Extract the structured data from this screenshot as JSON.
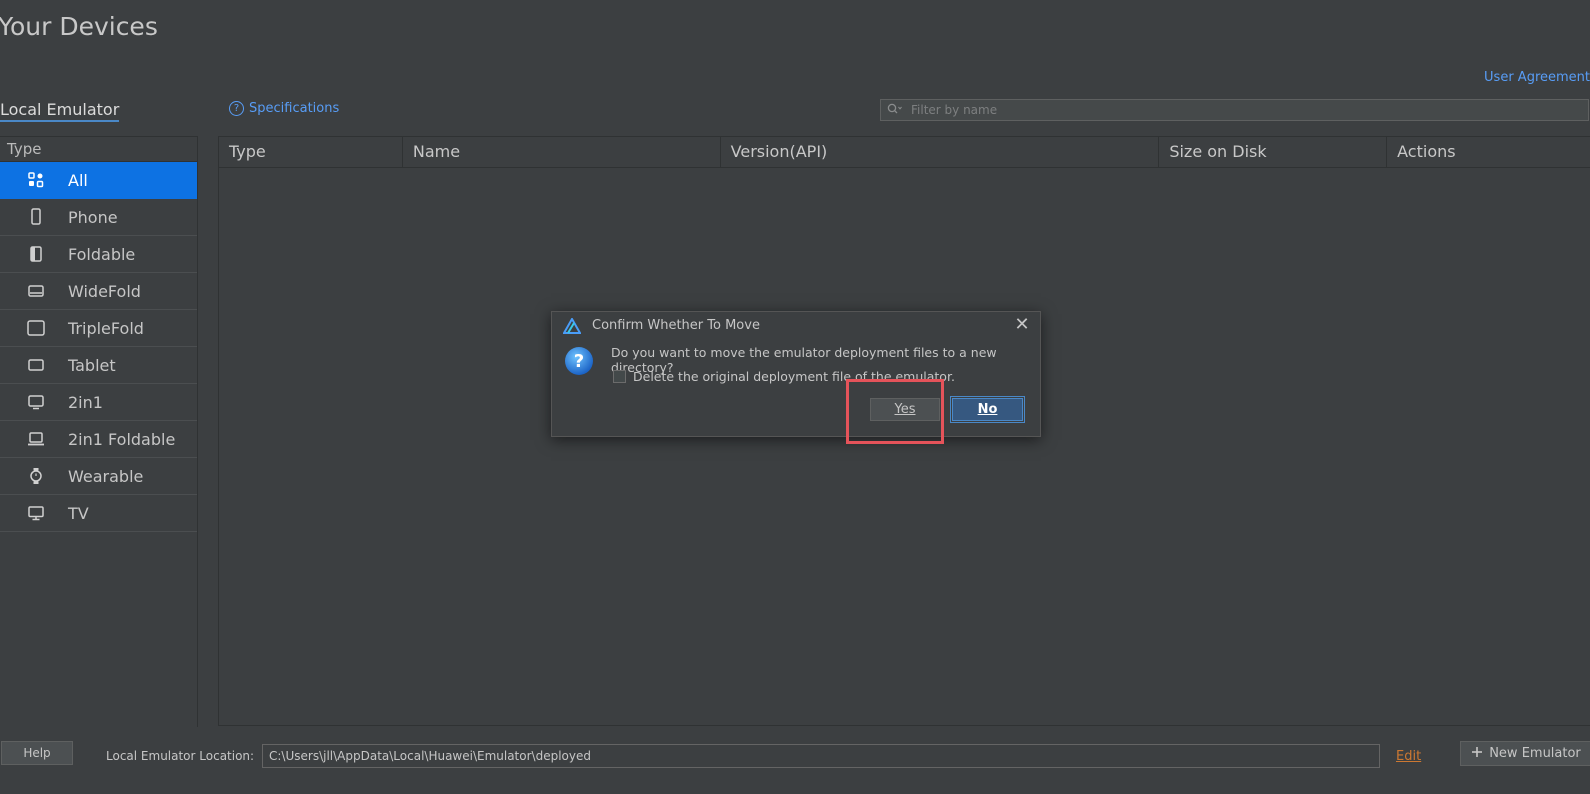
{
  "page": {
    "title": "Your Devices",
    "user_agreement": "User Agreement"
  },
  "tabs": {
    "local_emulator": "Local Emulator",
    "specifications": "Specifications"
  },
  "filter": {
    "placeholder": "Filter by name"
  },
  "sidebar": {
    "header": "Type",
    "items": [
      {
        "label": "All",
        "icon": "grid-icon",
        "active": true
      },
      {
        "label": "Phone",
        "icon": "phone-icon"
      },
      {
        "label": "Foldable",
        "icon": "foldable-icon"
      },
      {
        "label": "WideFold",
        "icon": "widefold-icon"
      },
      {
        "label": "TripleFold",
        "icon": "triplefold-icon"
      },
      {
        "label": "Tablet",
        "icon": "tablet-icon"
      },
      {
        "label": "2in1",
        "icon": "laptop-icon"
      },
      {
        "label": "2in1 Foldable",
        "icon": "laptop-foldable-icon"
      },
      {
        "label": "Wearable",
        "icon": "watch-icon"
      },
      {
        "label": "TV",
        "icon": "tv-icon"
      }
    ]
  },
  "table": {
    "columns": [
      "Type",
      "Name",
      "Version(API)",
      "Size on Disk",
      "Actions"
    ]
  },
  "bottom": {
    "help": "Help",
    "location_label": "Local Emulator Location:",
    "location_value": "C:\\Users\\jll\\AppData\\Local\\Huawei\\Emulator\\deployed",
    "edit": "Edit",
    "new_emulator": "New Emulator"
  },
  "dialog": {
    "title": "Confirm Whether To Move",
    "message": "Do you want to move the emulator deployment files to a new directory?",
    "checkbox_label": "Delete the original deployment file of the emulator.",
    "yes": "Yes",
    "no": "No"
  },
  "colors": {
    "accent": "#0d72e3",
    "link": "#589df6",
    "highlight": "#e5535a",
    "edit": "#cc7832"
  }
}
